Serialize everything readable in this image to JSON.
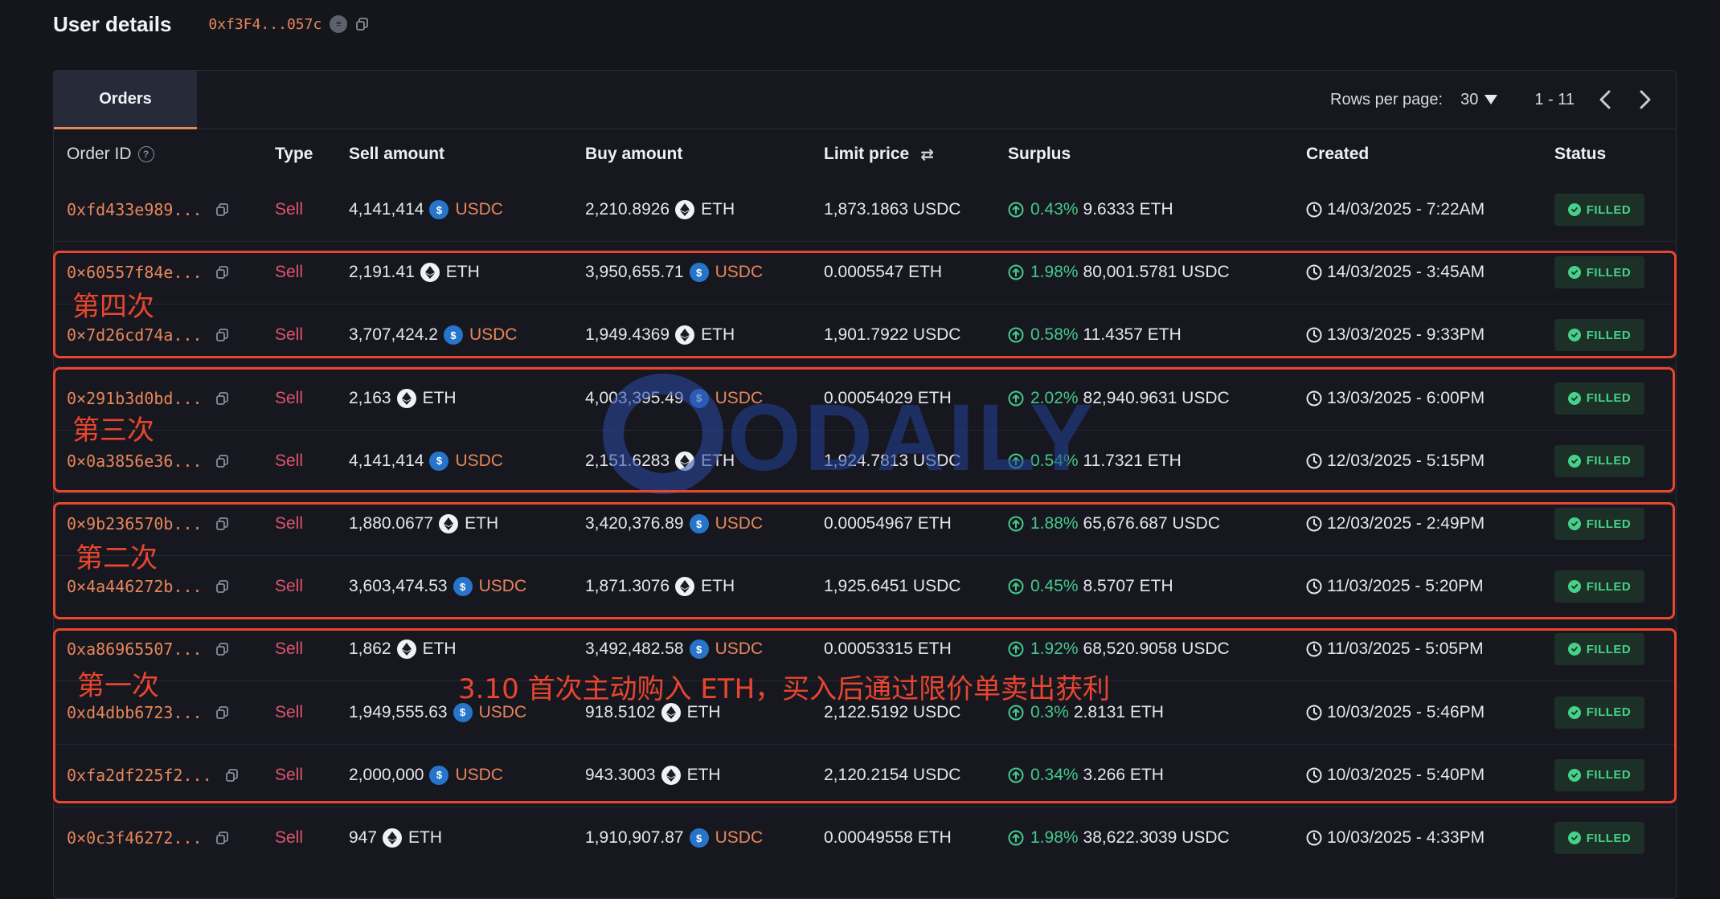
{
  "header": {
    "title": "User details",
    "address": "0xf3F4...057c"
  },
  "tabs": [
    {
      "label": "Orders",
      "active": true
    }
  ],
  "pagination": {
    "rows_label": "Rows per page:",
    "rows_value": "30",
    "range": "1 - 11"
  },
  "columns": {
    "order_id": "Order ID",
    "type": "Type",
    "sell_amount": "Sell amount",
    "buy_amount": "Buy amount",
    "limit_price": "Limit price",
    "surplus": "Surplus",
    "created": "Created",
    "status": "Status"
  },
  "orders": [
    {
      "id": "0xfd433e989...",
      "type": "Sell",
      "sell_amount": "4,141,414",
      "sell_token": "USDC",
      "buy_amount": "2,210.8926",
      "buy_token": "ETH",
      "limit_price": "1,873.1863 USDC",
      "surplus_pct": "0.43%",
      "surplus_amount": "9.6333 ETH",
      "created": "14/03/2025 - 7:22AM",
      "status": "FILLED"
    },
    {
      "id": "0×60557f84e...",
      "type": "Sell",
      "sell_amount": "2,191.41",
      "sell_token": "ETH",
      "buy_amount": "3,950,655.71",
      "buy_token": "USDC",
      "limit_price": "0.0005547 ETH",
      "surplus_pct": "1.98%",
      "surplus_amount": "80,001.5781 USDC",
      "created": "14/03/2025 - 3:45AM",
      "status": "FILLED"
    },
    {
      "id": "0×7d26cd74a...",
      "type": "Sell",
      "sell_amount": "3,707,424.2",
      "sell_token": "USDC",
      "buy_amount": "1,949.4369",
      "buy_token": "ETH",
      "limit_price": "1,901.7922 USDC",
      "surplus_pct": "0.58%",
      "surplus_amount": "11.4357 ETH",
      "created": "13/03/2025 - 9:33PM",
      "status": "FILLED"
    },
    {
      "id": "0×291b3d0bd...",
      "type": "Sell",
      "sell_amount": "2,163",
      "sell_token": "ETH",
      "buy_amount": "4,003,395.49",
      "buy_token": "USDC",
      "limit_price": "0.00054029 ETH",
      "surplus_pct": "2.02%",
      "surplus_amount": "82,940.9631 USDC",
      "created": "13/03/2025 - 6:00PM",
      "status": "FILLED"
    },
    {
      "id": "0×0a3856e36...",
      "type": "Sell",
      "sell_amount": "4,141,414",
      "sell_token": "USDC",
      "buy_amount": "2,151.6283",
      "buy_token": "ETH",
      "limit_price": "1,924.7813 USDC",
      "surplus_pct": "0.54%",
      "surplus_amount": "11.7321 ETH",
      "created": "12/03/2025 - 5:15PM",
      "status": "FILLED"
    },
    {
      "id": "0×9b236570b...",
      "type": "Sell",
      "sell_amount": "1,880.0677",
      "sell_token": "ETH",
      "buy_amount": "3,420,376.89",
      "buy_token": "USDC",
      "limit_price": "0.00054967 ETH",
      "surplus_pct": "1.88%",
      "surplus_amount": "65,676.687 USDC",
      "created": "12/03/2025 - 2:49PM",
      "status": "FILLED"
    },
    {
      "id": "0×4a446272b...",
      "type": "Sell",
      "sell_amount": "3,603,474.53",
      "sell_token": "USDC",
      "buy_amount": "1,871.3076",
      "buy_token": "ETH",
      "limit_price": "1,925.6451 USDC",
      "surplus_pct": "0.45%",
      "surplus_amount": "8.5707 ETH",
      "created": "11/03/2025 - 5:20PM",
      "status": "FILLED"
    },
    {
      "id": "0xa86965507...",
      "type": "Sell",
      "sell_amount": "1,862",
      "sell_token": "ETH",
      "buy_amount": "3,492,482.58",
      "buy_token": "USDC",
      "limit_price": "0.00053315 ETH",
      "surplus_pct": "1.92%",
      "surplus_amount": "68,520.9058 USDC",
      "created": "11/03/2025 - 5:05PM",
      "status": "FILLED"
    },
    {
      "id": "0xd4dbb6723...",
      "type": "Sell",
      "sell_amount": "1,949,555.63",
      "sell_token": "USDC",
      "buy_amount": "918.5102",
      "buy_token": "ETH",
      "limit_price": "2,122.5192 USDC",
      "surplus_pct": "0.3%",
      "surplus_amount": "2.8131 ETH",
      "created": "10/03/2025 - 5:46PM",
      "status": "FILLED"
    },
    {
      "id": "0xfa2df225f2...",
      "type": "Sell",
      "sell_amount": "2,000,000",
      "sell_token": "USDC",
      "buy_amount": "943.3003",
      "buy_token": "ETH",
      "limit_price": "2,120.2154 USDC",
      "surplus_pct": "0.34%",
      "surplus_amount": "3.266 ETH",
      "created": "10/03/2025 - 5:40PM",
      "status": "FILLED"
    },
    {
      "id": "0×0c3f46272...",
      "type": "Sell",
      "sell_amount": "947",
      "sell_token": "ETH",
      "buy_amount": "1,910,907.87",
      "buy_token": "USDC",
      "limit_price": "0.00049558 ETH",
      "surplus_pct": "1.98%",
      "surplus_amount": "38,622.3039 USDC",
      "created": "10/03/2025 - 4:33PM",
      "status": "FILLED"
    }
  ],
  "annotations": {
    "group4": "第四次",
    "group3": "第三次",
    "group2": "第二次",
    "group1": "第一次",
    "note": "3.10 首次主动购入 ETH，买入后通过限价单卖出获利"
  },
  "watermark": {
    "text": "ODAILY"
  },
  "colors": {
    "background": "#15161c",
    "accent_orange": "#e7865a",
    "sell_red": "#e0556b",
    "surplus_green": "#44c98b",
    "annotation_red": "#e9452f",
    "usdc_blue": "#2775ca"
  },
  "icons": [
    "copy-icon",
    "explorer-logo-icon",
    "help-icon",
    "swap-arrows-icon",
    "usdc-icon",
    "eth-icon",
    "arrow-up-circle-icon",
    "clock-icon",
    "check-circle-icon",
    "chevron-left-icon",
    "chevron-right-icon",
    "caret-down-icon"
  ]
}
